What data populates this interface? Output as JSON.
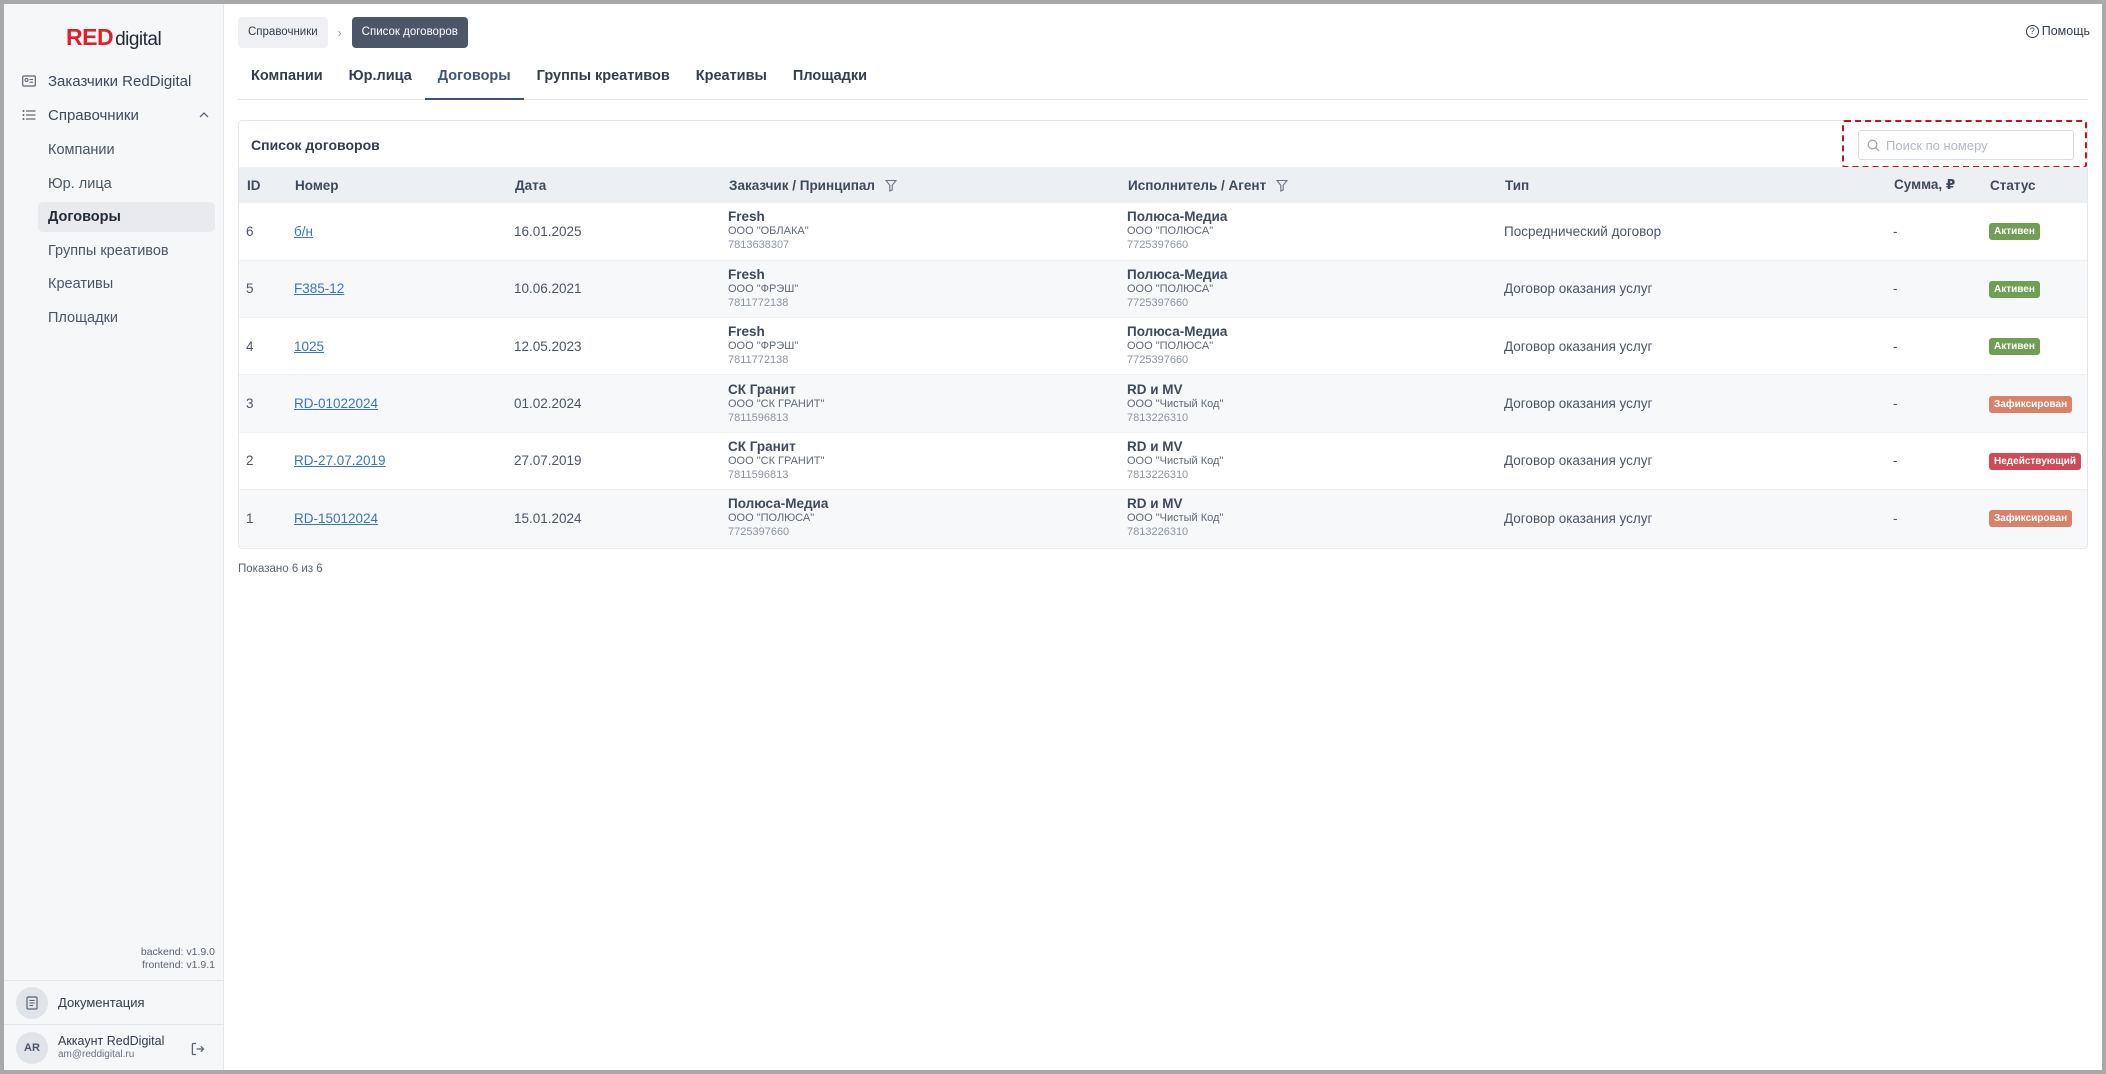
{
  "logo": {
    "red": "RED",
    "digital": "digital"
  },
  "sidebar": {
    "customers": "Заказчики RedDigital",
    "references": "Справочники",
    "sub_items": [
      {
        "label": "Компании",
        "active": false
      },
      {
        "label": "Юр. лица",
        "active": false
      },
      {
        "label": "Договоры",
        "active": true
      },
      {
        "label": "Группы креативов",
        "active": false
      },
      {
        "label": "Креативы",
        "active": false
      },
      {
        "label": "Площадки",
        "active": false
      }
    ],
    "backend_version": "backend: v1.9.0",
    "frontend_version": "frontend: v1.9.1",
    "docs": "Документация",
    "account": {
      "initials": "AR",
      "name": "Аккаунт RedDigital",
      "email": "am@reddigital.ru"
    }
  },
  "breadcrumb": {
    "parent": "Справочники",
    "current": "Список договоров"
  },
  "help": "Помощь",
  "tabs": [
    {
      "label": "Компании",
      "active": false
    },
    {
      "label": "Юр.лица",
      "active": false
    },
    {
      "label": "Договоры",
      "active": true
    },
    {
      "label": "Группы креативов",
      "active": false
    },
    {
      "label": "Креативы",
      "active": false
    },
    {
      "label": "Площадки",
      "active": false
    }
  ],
  "card": {
    "title": "Список договоров",
    "search_placeholder": "Поиск по номеру"
  },
  "table": {
    "columns": {
      "id": "ID",
      "number": "Номер",
      "date": "Дата",
      "customer": "Заказчик / Принципал",
      "executor": "Исполнитель / Агент",
      "type": "Тип",
      "sum": "Сумма, ₽",
      "status": "Статус"
    },
    "rows": [
      {
        "id": "6",
        "number": "б/н",
        "date": "16.01.2025",
        "customer": {
          "name": "Fresh",
          "org": "ООО \"ОБЛАКА\"",
          "inn": "7813638307"
        },
        "executor": {
          "name": "Полюса-Медиа",
          "org": "ООО \"ПОЛЮСА\"",
          "inn": "7725397660"
        },
        "type": "Посреднический договор",
        "sum": "-",
        "status": "Активен",
        "status_color": "#6f9f55"
      },
      {
        "id": "5",
        "number": "F385-12",
        "date": "10.06.2021",
        "customer": {
          "name": "Fresh",
          "org": "ООО \"ФРЭШ\"",
          "inn": "7811772138"
        },
        "executor": {
          "name": "Полюса-Медиа",
          "org": "ООО \"ПОЛЮСА\"",
          "inn": "7725397660"
        },
        "type": "Договор оказания услуг",
        "sum": "-",
        "status": "Активен",
        "status_color": "#6f9f55"
      },
      {
        "id": "4",
        "number": "1025",
        "date": "12.05.2023",
        "customer": {
          "name": "Fresh",
          "org": "ООО \"ФРЭШ\"",
          "inn": "7811772138"
        },
        "executor": {
          "name": "Полюса-Медиа",
          "org": "ООО \"ПОЛЮСА\"",
          "inn": "7725397660"
        },
        "type": "Договор оказания услуг",
        "sum": "-",
        "status": "Активен",
        "status_color": "#6f9f55"
      },
      {
        "id": "3",
        "number": "RD-01022024",
        "date": "01.02.2024",
        "customer": {
          "name": "СК Гранит",
          "org": "ООО \"СК ГРАНИТ\"",
          "inn": "7811596813"
        },
        "executor": {
          "name": "RD и MV",
          "org": "ООО \"Чистый Код\"",
          "inn": "7813226310"
        },
        "type": "Договор оказания услуг",
        "sum": "-",
        "status": "Зафиксирован",
        "status_color": "#d9826a"
      },
      {
        "id": "2",
        "number": "RD-27.07.2019",
        "date": "27.07.2019",
        "customer": {
          "name": "СК Гранит",
          "org": "ООО \"СК ГРАНИТ\"",
          "inn": "7811596813"
        },
        "executor": {
          "name": "RD и MV",
          "org": "ООО \"Чистый Код\"",
          "inn": "7813226310"
        },
        "type": "Договор оказания услуг",
        "sum": "-",
        "status": "Недействующий",
        "status_color": "#cf4b57"
      },
      {
        "id": "1",
        "number": "RD-15012024",
        "date": "15.01.2024",
        "customer": {
          "name": "Полюса-Медиа",
          "org": "ООО \"ПОЛЮСА\"",
          "inn": "7725397660"
        },
        "executor": {
          "name": "RD и MV",
          "org": "ООО \"Чистый Код\"",
          "inn": "7813226310"
        },
        "type": "Договор оказания услуг",
        "sum": "-",
        "status": "Зафиксирован",
        "status_color": "#d9826a"
      }
    ]
  },
  "shown_text": "Показано 6 из 6"
}
